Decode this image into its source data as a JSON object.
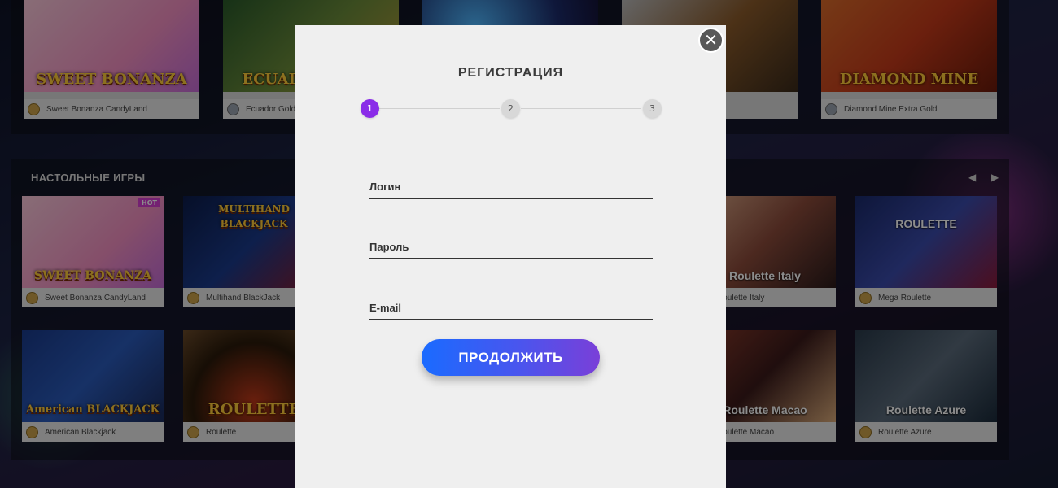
{
  "section": {
    "table_games_title": "НАСТОЛЬНЫЕ ИГРЫ"
  },
  "top_row": [
    {
      "name": "Sweet Bonanza CandyLand",
      "art": "SWEET BONANZA",
      "icon": "coin-icon"
    },
    {
      "name": "Ecuador Gold",
      "art": "ECUADOR GOLD",
      "icon": "provider-icon"
    },
    {
      "name": "",
      "art": "",
      "icon": ""
    },
    {
      "name": "",
      "art": "",
      "icon": ""
    },
    {
      "name": "Diamond Mine Extra Gold",
      "art": "DIAMOND MINE",
      "icon": "provider-icon"
    }
  ],
  "table_games": [
    {
      "name": "Sweet Bonanza CandyLand",
      "art": "SWEET BONANZA",
      "badge": "HOT"
    },
    {
      "name": "Multihand BlackJack",
      "art": "MULTIHAND BLACKJACK"
    },
    {
      "name": "Roulette Italy",
      "art": "Roulette Italy"
    },
    {
      "name": "Mega Roulette",
      "art": "ROULETTE"
    },
    {
      "name": "American Blackjack",
      "art": "American BLACKJACK"
    },
    {
      "name": "Roulette",
      "art": "ROULETTE"
    },
    {
      "name": "Roulette Macao",
      "art": "Roulette Macao"
    },
    {
      "name": "Roulette Azure",
      "art": "Roulette Azure"
    }
  ],
  "modal": {
    "title": "РЕГИСТРАЦИЯ",
    "steps": [
      "1",
      "2",
      "3"
    ],
    "active_step": 1,
    "fields": {
      "login_placeholder": "Логин",
      "password_placeholder": "Пароль",
      "email_placeholder": "E-mail"
    },
    "continue_label": "ПРОДОЛЖИТЬ",
    "close_icon": "close-icon"
  },
  "colors": {
    "accent_purple": "#8a2ce8",
    "button_gradient_start": "#1a6bff",
    "button_gradient_end": "#7a3fd8",
    "modal_bg": "#efefef"
  }
}
